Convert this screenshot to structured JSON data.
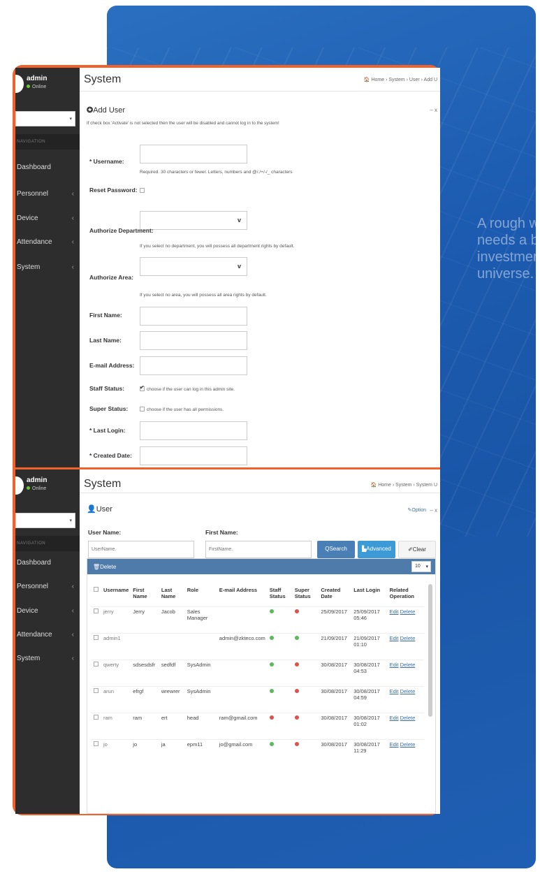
{
  "bg_tagline": [
    "A rough wo",
    "needs a bi",
    "investment",
    "universe."
  ],
  "sidebar": {
    "user": "admin",
    "status": "Online",
    "nav_header": "NAVIGATION",
    "items": [
      {
        "label": "Dashboard"
      },
      {
        "label": "Personnel"
      },
      {
        "label": "Device"
      },
      {
        "label": "Attendance"
      },
      {
        "label": "System"
      }
    ],
    "chevron": "‹"
  },
  "form_panel": {
    "title": "System",
    "breadcrumb": "🏠 Home › System › User › Add U",
    "section_title": "Add User",
    "section_controls": "– x",
    "notice": "If check box 'Activate' is not selected then the user will be disabled and cannot log in to the system!",
    "fields": {
      "username_label": "* Username:",
      "username_hint": "Required. 30 characters or fewer. Letters, numbers and @/./+/-/_ characters",
      "reset_password_label": "Reset Password:",
      "authorize_department_label": "Authorize Department:",
      "department_hint": "If you select no department, you will possess all department rights by default.",
      "authorize_area_label": "Authorize Area:",
      "area_hint": "If you select no area, you will possess all area rights by default.",
      "first_name_label": "First Name:",
      "last_name_label": "Last Name:",
      "email_label": "E-mail Address:",
      "staff_status_label": "Staff Status:",
      "staff_status_hint": "choose if the user can log in this admin site.",
      "super_status_label": "Super Status:",
      "super_status_hint": "choose if the user has all permissions.",
      "last_login_label": "* Last Login:",
      "created_date_label": "* Created Date:"
    }
  },
  "list_panel": {
    "title": "System",
    "breadcrumb": "🏠 Home › System › System U",
    "section_title": "User",
    "option_label": "Option",
    "section_controls": "– x",
    "filters": {
      "user_name_label": "User Name:",
      "user_name_placeholder": "UserName.",
      "first_name_label": "First Name:",
      "first_name_placeholder": "FirstName."
    },
    "buttons": {
      "search": "Search",
      "advanced": "Advanced",
      "clear": "Clear"
    },
    "table": {
      "delete_label": "Delete",
      "page_size": "10",
      "columns": [
        "Username",
        "First Name",
        "Last Name",
        "Role",
        "E-mail Address",
        "Staff Status",
        "Super Status",
        "Created Date",
        "Last Login",
        "Related Operation"
      ],
      "rows": [
        {
          "username": "jerry",
          "first": "Jerry",
          "last": "Jacob",
          "role": "Sales Manager",
          "email": "",
          "staff": "green",
          "super": "red",
          "created": "25/09/2017",
          "last_login": "25/09/2017 05:46"
        },
        {
          "username": "admin1",
          "first": "",
          "last": "",
          "role": "",
          "email": "admin@zkteco.com",
          "staff": "green",
          "super": "green",
          "created": "21/09/2017",
          "last_login": "21/09/2017 01:10"
        },
        {
          "username": "qwerty",
          "first": "sdsesdsfr",
          "last": "sedfdf",
          "role": "SysAdmin",
          "email": "",
          "staff": "green",
          "super": "red",
          "created": "30/08/2017",
          "last_login": "30/08/2017 04:53"
        },
        {
          "username": "arun",
          "first": "efrgf",
          "last": "wrewrer",
          "role": "SysAdmin",
          "email": "",
          "staff": "green",
          "super": "red",
          "created": "30/08/2017",
          "last_login": "30/08/2017 04:59"
        },
        {
          "username": "ram",
          "first": "ram",
          "last": "ert",
          "role": "head",
          "email": "ram@gmail.com",
          "staff": "red",
          "super": "red",
          "created": "30/08/2017",
          "last_login": "30/08/2017 01:02"
        },
        {
          "username": "jo",
          "first": "jo",
          "last": "ja",
          "role": "epm11",
          "email": "jo@gmail.com",
          "staff": "green",
          "super": "red",
          "created": "30/08/2017",
          "last_login": "30/08/2017 11:29"
        }
      ],
      "edit_label": "Edit",
      "delete_link": "Delete"
    }
  }
}
